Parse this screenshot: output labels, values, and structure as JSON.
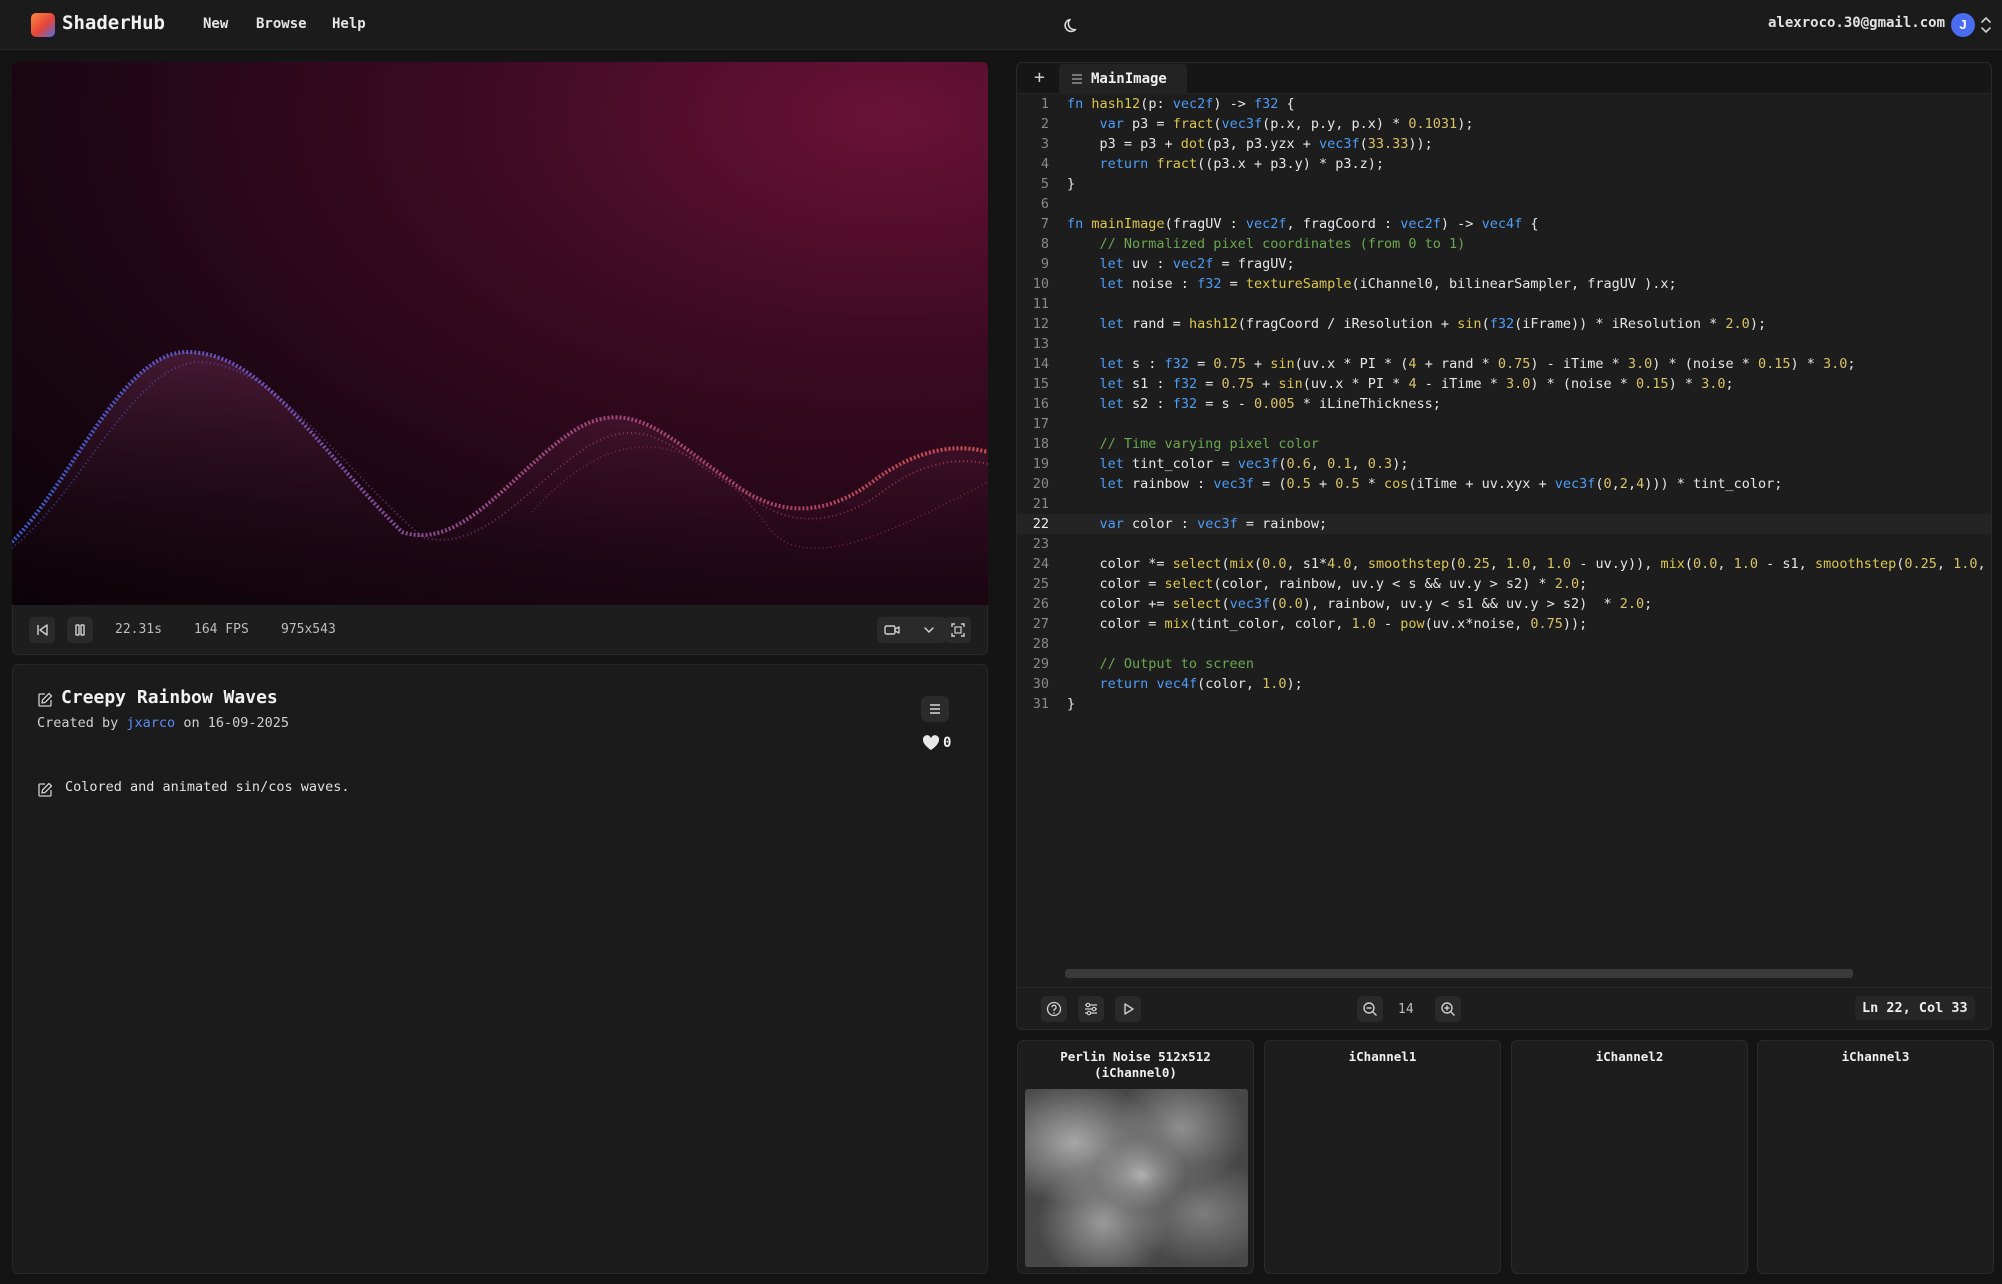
{
  "app": {
    "brand": "ShaderHub",
    "nav": [
      "New",
      "Browse",
      "Help"
    ],
    "user_email": "alexroco.30@gmail.com",
    "avatar_initial": "J",
    "accent_color": "#4a6cf0"
  },
  "player": {
    "time": "22.31s",
    "fps": "164 FPS",
    "resolution": "975x543"
  },
  "shader": {
    "title": "Creepy Rainbow Waves",
    "created_prefix": "Created by",
    "author": "jxarco",
    "date_prefix": "on",
    "date": "16-09-2025",
    "likes": "0",
    "description": "Colored and animated sin/cos waves."
  },
  "editor": {
    "add_tab": "+",
    "tab": "MainImage",
    "active_line": 22,
    "font_size": "14",
    "cursor": "Ln 22, Col 33",
    "lines": [
      "fn hash12(p: vec2f) -> f32 {",
      "    var p3 = fract(vec3f(p.x, p.y, p.x) * 0.1031);",
      "    p3 = p3 + dot(p3, p3.yzx + vec3f(33.33));",
      "    return fract((p3.x + p3.y) * p3.z);",
      "}",
      "",
      "fn mainImage(fragUV : vec2f, fragCoord : vec2f) -> vec4f {",
      "    // Normalized pixel coordinates (from 0 to 1)",
      "    let uv : vec2f = fragUV;",
      "    let noise : f32 = textureSample(iChannel0, bilinearSampler, fragUV ).x;",
      "",
      "    let rand = hash12(fragCoord / iResolution + sin(f32(iFrame)) * iResolution * 2.0);",
      "",
      "    let s : f32 = 0.75 + sin(uv.x * PI * (4 + rand * 0.75) - iTime * 3.0) * (noise * 0.15) * 3.0;",
      "    let s1 : f32 = 0.75 + sin(uv.x * PI * 4 - iTime * 3.0) * (noise * 0.15) * 3.0;",
      "    let s2 : f32 = s - 0.005 * iLineThickness;",
      "",
      "    // Time varying pixel color",
      "    let tint_color = vec3f(0.6, 0.1, 0.3);",
      "    let rainbow : vec3f = (0.5 + 0.5 * cos(iTime + uv.xyx + vec3f(0,2,4))) * tint_color;",
      "",
      "    var color : vec3f = rainbow;",
      "",
      "    color *= select(mix(0.0, s1*4.0, smoothstep(0.25, 1.0, 1.0 - uv.y)), mix(0.0, 1.0 - s1, smoothstep(0.25, 1.0,",
      "    color = select(color, rainbow, uv.y < s && uv.y > s2) * 2.0;",
      "    color += select(vec3f(0.0), rainbow, uv.y < s1 && uv.y > s2)  * 2.0;",
      "    color = mix(tint_color, color, 1.0 - pow(uv.x*noise, 0.75));",
      "",
      "    // Output to screen",
      "    return vec4f(color, 1.0);",
      "}"
    ]
  },
  "channels": [
    {
      "label": "Perlin Noise 512x512 (iChannel0)",
      "has_texture": true
    },
    {
      "label": "iChannel1",
      "has_texture": false
    },
    {
      "label": "iChannel2",
      "has_texture": false
    },
    {
      "label": "iChannel3",
      "has_texture": false
    }
  ]
}
